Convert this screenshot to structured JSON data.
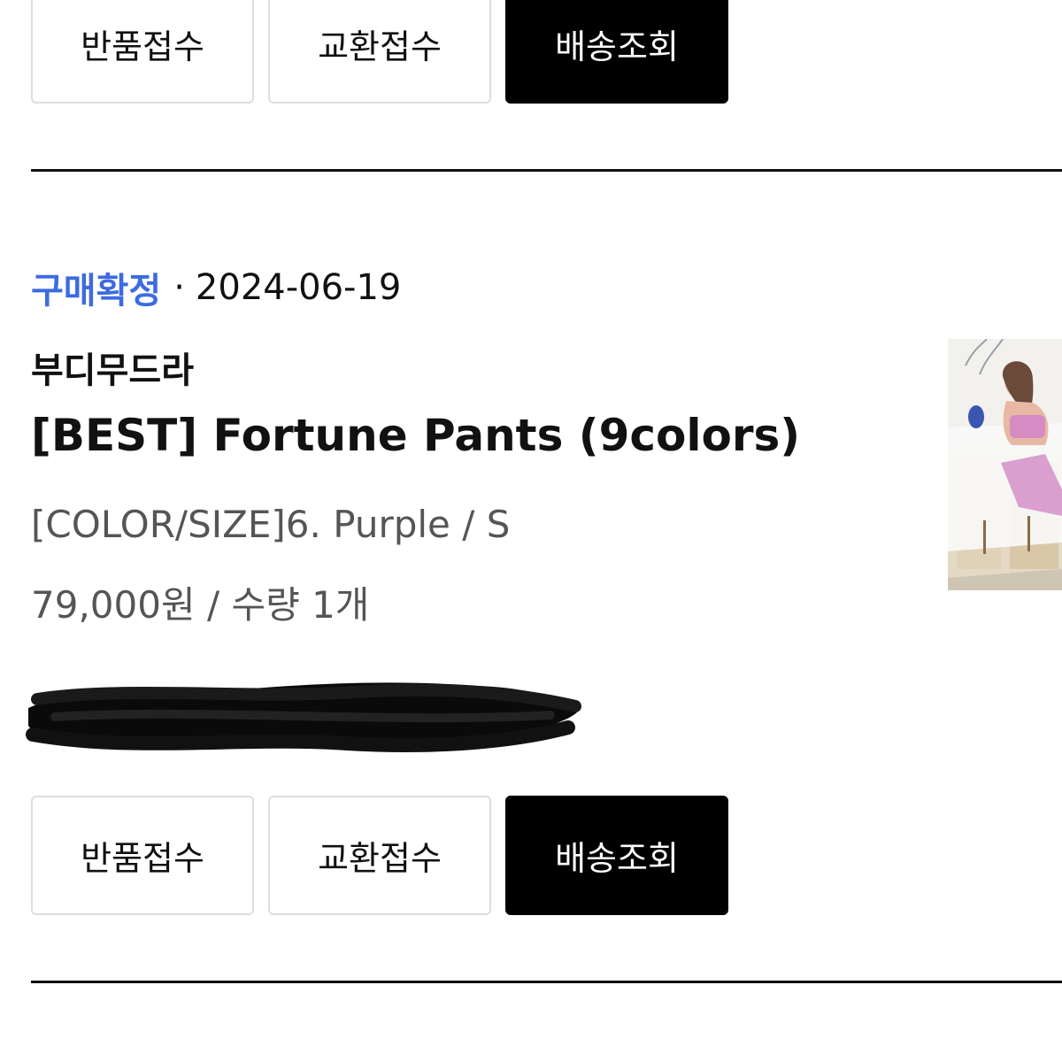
{
  "actions_top": {
    "return_label": "반품접수",
    "exchange_label": "교환접수",
    "track_label": "배송조회"
  },
  "order": {
    "status": "구매확정",
    "separator": "·",
    "date": "2024-06-19",
    "brand": "부디무드라",
    "product_name": "[BEST] Fortune Pants (9colors)",
    "option": "[COLOR/SIZE]6. Purple / S",
    "price_qty": "79,000원 / 수량 1개"
  },
  "actions_bottom": {
    "return_label": "반품접수",
    "exchange_label": "교환접수",
    "track_label": "배송조회"
  },
  "colors": {
    "status_blue": "#3d6be0",
    "button_dark": "#000000",
    "divider": "#111111",
    "muted_text": "#555555"
  },
  "icons": {
    "thumbnail": "product-thumbnail-photo",
    "redaction": "scribble-redaction"
  }
}
